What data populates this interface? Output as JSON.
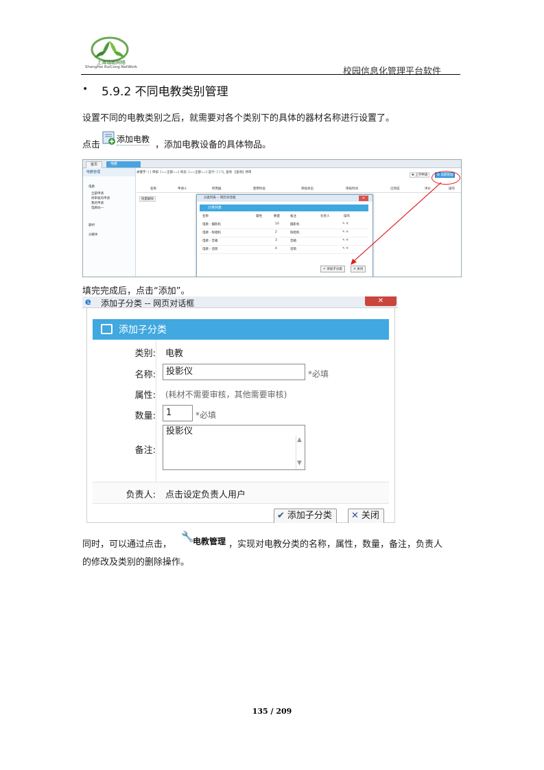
{
  "header": {
    "logo_name": "上海瑞聪网络",
    "logo_sub": "ShangHai RuiCong.NetWork",
    "doc_title": "校园信息化管理平台软件"
  },
  "section": {
    "bullet": "•",
    "title": "5.9.2 不同电教类别管理"
  },
  "paragraphs": {
    "p1": "设置不同的电教类别之后，就需要对各个类别下的具体的器材名称进行设置了。",
    "p2_before": "点击",
    "p2_button": "添加电教",
    "p2_after": "，添加电教设备的具体物品。",
    "p3": "填完完成后，点击“添加”。",
    "p4_before": "同时，可以通过点击，",
    "p4_button": "电教管理",
    "p4_after": "，实现对电教分类的名称，属性，数量，备注，负责人",
    "p4_line2": "的修改及类别的删除操作。"
  },
  "screenshot1": {
    "tabs": {
      "home": "首页",
      "active": "电教"
    },
    "sidebar_title": "电教管理",
    "sidebar_items": [
      "电教",
      "全部申请",
      "待审核的申请",
      "我的申请",
      "电教局一",
      "器材",
      "分解体"
    ],
    "toolbar": "关键字: [        ] 审核: [==全部==] 状态: [==全部==] 是什: [  ] 🔍 查询  【查询】待审",
    "top_buttons": {
      "apply": "✚ 上学申请",
      "manage": "⚙ 电教管理"
    },
    "columns": [
      "名称",
      "申请人",
      "所用器",
      "使用时段",
      "审核状态",
      "审核时间",
      "已完成",
      "评价",
      "操作"
    ],
    "batch_button": "批量删除",
    "dialog": {
      "title": "分类列表 -- 网页对话框",
      "band": "分类列表",
      "columns": [
        "名称",
        "属性",
        "数量",
        "备注",
        "负责人",
        "操作"
      ],
      "rows": [
        [
          "电教 - 摄影机",
          "",
          "10",
          "摄影机",
          "",
          "✎ ✕"
        ],
        [
          "电教 - 照相机",
          "",
          "2",
          "照相机",
          "",
          "✎ ✕"
        ],
        [
          "电教 - 音箱",
          "",
          "3",
          "音箱",
          "",
          "✎ ✕"
        ],
        [
          "电教 - 话筒",
          "",
          "4",
          "话筒",
          "",
          "✎ ✕"
        ]
      ],
      "add_button": "✔ 添加子分类",
      "close_button": "✕ 关闭"
    }
  },
  "screenshot2": {
    "window_title": "添加子分类 -- 网页对话框",
    "band_title": "添加子分类",
    "fields": {
      "category_label": "类别:",
      "category_value": "电教",
      "name_label": "名称:",
      "name_value": "投影仪",
      "name_required": "*必填",
      "attr_label": "属性:",
      "attr_hint": "(耗材不需要审核，其他需要审核)",
      "qty_label": "数量:",
      "qty_value": "1",
      "qty_required": "*必填",
      "note_label": "备注:",
      "note_value": "投影仪",
      "resp_label": "负责人:",
      "resp_value": "点击设定负责人用户"
    },
    "buttons": {
      "add": "添加子分类",
      "close": "关闭"
    }
  },
  "footer": {
    "page": "135 / 209"
  },
  "colors": {
    "accent": "#41a8e0",
    "highlight": "#e02020"
  }
}
